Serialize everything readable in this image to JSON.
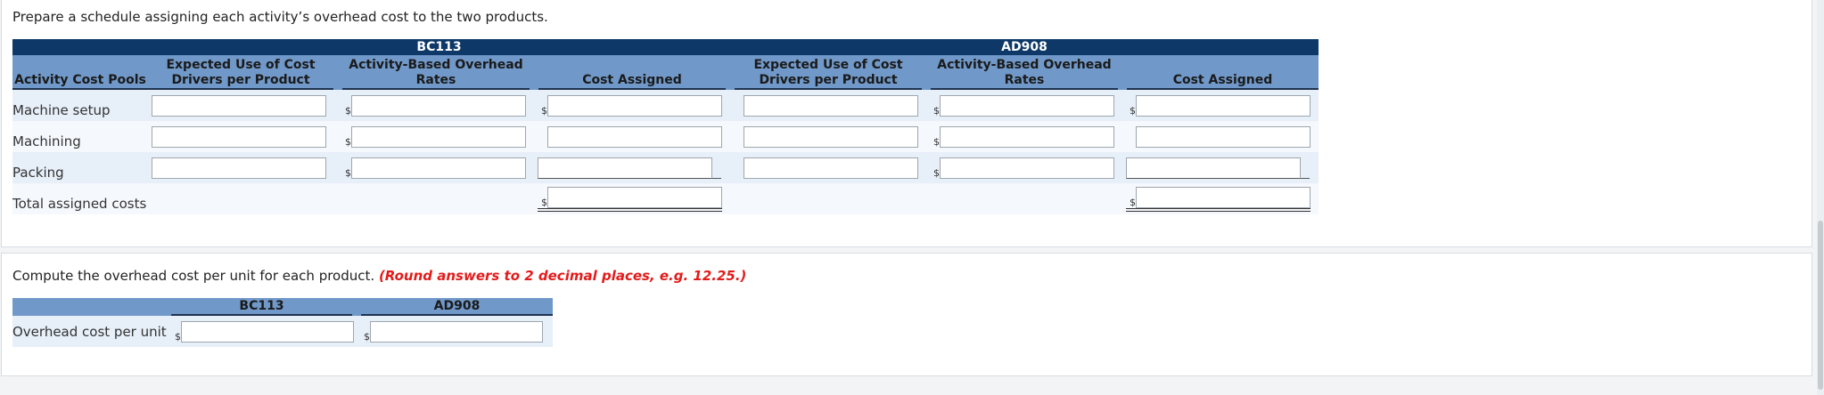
{
  "section1": {
    "instruction": "Prepare a schedule assigning each activity’s overhead cost to the two products.",
    "products": [
      "BC113",
      "AD908"
    ],
    "headers": {
      "pools": "Activity Cost Pools",
      "expected": "Expected Use of Cost Drivers per Product",
      "rates": "Activity-Based Overhead Rates",
      "cost": "Cost Assigned"
    },
    "rows": [
      {
        "label": "Machine setup"
      },
      {
        "label": "Machining"
      },
      {
        "label": "Packing"
      }
    ],
    "total_label": "Total assigned costs",
    "currency": "$"
  },
  "section2": {
    "instruction": "Compute the overhead cost per unit for each product.",
    "hint": "(Round answers to 2 decimal places, e.g. 12.25.)",
    "products": [
      "BC113",
      "AD908"
    ],
    "row_label": "Overhead cost per unit",
    "currency": "$"
  },
  "colors": {
    "header_dark": "#0d3868",
    "header_light": "#7098c8",
    "row_shade": "#e7eff9",
    "hint_red": "#e31b1b"
  }
}
